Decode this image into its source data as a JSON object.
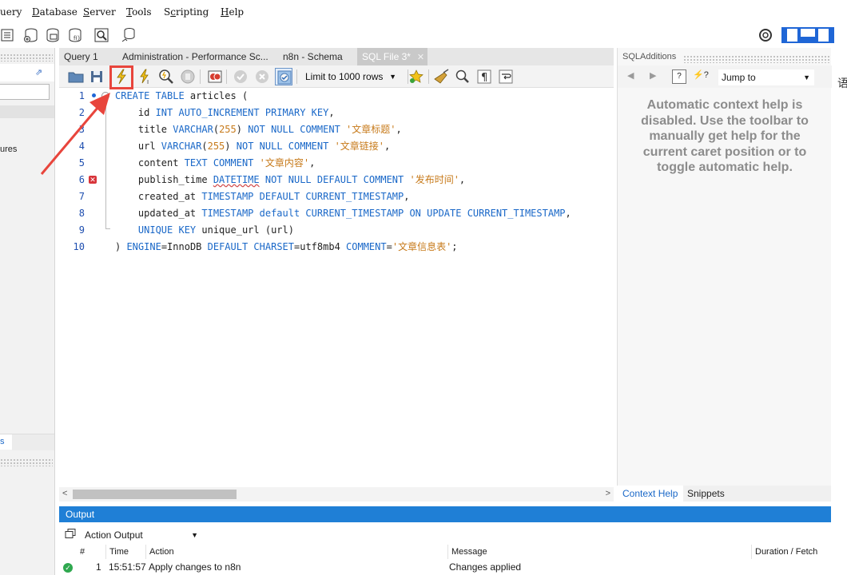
{
  "menu": [
    "uery",
    "Database",
    "Server",
    "Tools",
    "Scripting",
    "Help"
  ],
  "menu_mnemonics": {
    "Database": "D",
    "Server": "S",
    "Tools": "T",
    "Scripting": "c",
    "Help": "H"
  },
  "sidebar": {
    "partial_item": "ures",
    "partial_tab": "s"
  },
  "tabs": [
    {
      "label": "Query 1",
      "active": false
    },
    {
      "label": "Administration - Performance Sc...",
      "active": false
    },
    {
      "label": "n8n - Schema",
      "active": false
    },
    {
      "label": "SQL File 3*",
      "active": true
    }
  ],
  "editor_toolbar": {
    "limit_select": "Limit to 1000 rows"
  },
  "code_lines": [
    {
      "n": "1",
      "tokens": [
        [
          "kw",
          "CREATE TABLE "
        ],
        [
          "id",
          "articles ("
        ]
      ]
    },
    {
      "n": "2",
      "tokens": [
        [
          "id",
          "    id "
        ],
        [
          "kw",
          "INT AUTO_INCREMENT PRIMARY KEY"
        ],
        [
          "pn",
          ","
        ]
      ]
    },
    {
      "n": "3",
      "tokens": [
        [
          "id",
          "    title "
        ],
        [
          "kw",
          "VARCHAR"
        ],
        [
          "pn",
          "("
        ],
        [
          "str",
          "255"
        ],
        [
          "pn",
          ") "
        ],
        [
          "kw",
          "NOT NULL COMMENT "
        ],
        [
          "str",
          "'文章标题'"
        ],
        [
          "pn",
          ","
        ]
      ]
    },
    {
      "n": "4",
      "tokens": [
        [
          "id",
          "    url "
        ],
        [
          "kw",
          "VARCHAR"
        ],
        [
          "pn",
          "("
        ],
        [
          "str",
          "255"
        ],
        [
          "pn",
          ") "
        ],
        [
          "kw",
          "NOT NULL COMMENT "
        ],
        [
          "str",
          "'文章链接'"
        ],
        [
          "pn",
          ","
        ]
      ]
    },
    {
      "n": "5",
      "tokens": [
        [
          "id",
          "    content "
        ],
        [
          "kw",
          "TEXT COMMENT "
        ],
        [
          "str",
          "'文章内容'"
        ],
        [
          "pn",
          ","
        ]
      ]
    },
    {
      "n": "6",
      "tokens": [
        [
          "id",
          "    publish_time "
        ],
        [
          "err",
          "DATETIME"
        ],
        [
          "kw",
          " NOT NULL DEFAULT COMMENT "
        ],
        [
          "str",
          "'发布时间'"
        ],
        [
          "pn",
          ","
        ]
      ]
    },
    {
      "n": "7",
      "tokens": [
        [
          "id",
          "    created_at "
        ],
        [
          "kw",
          "TIMESTAMP DEFAULT CURRENT_TIMESTAMP"
        ],
        [
          "pn",
          ","
        ]
      ]
    },
    {
      "n": "8",
      "tokens": [
        [
          "id",
          "    updated_at "
        ],
        [
          "kw",
          "TIMESTAMP default CURRENT_TIMESTAMP ON UPDATE CURRENT_TIMESTAMP"
        ],
        [
          "pn",
          ","
        ]
      ]
    },
    {
      "n": "9",
      "tokens": [
        [
          "kw",
          "    UNIQUE KEY "
        ],
        [
          "id",
          "unique_url (url)"
        ]
      ]
    },
    {
      "n": "10",
      "tokens": [
        [
          "id",
          ") "
        ],
        [
          "kw",
          "ENGINE"
        ],
        [
          "pn",
          "="
        ],
        [
          "id",
          "InnoDB "
        ],
        [
          "kw",
          "DEFAULT CHARSET"
        ],
        [
          "pn",
          "="
        ],
        [
          "id",
          "utf8mb4 "
        ],
        [
          "kw",
          "COMMENT"
        ],
        [
          "pn",
          "="
        ],
        [
          "str",
          "'文章信息表'"
        ],
        [
          "pn",
          ";"
        ]
      ]
    }
  ],
  "right_panel": {
    "title": "SQLAdditions",
    "jump_to": "Jump to",
    "help_text": "Automatic context help is disabled. Use the toolbar to manually get help for the current caret position or to toggle automatic help.",
    "tabs": [
      "Context Help",
      "Snippets"
    ]
  },
  "output": {
    "header": "Output",
    "select": "Action Output",
    "columns": [
      "#",
      "Time",
      "Action",
      "Message",
      "Duration / Fetch"
    ],
    "rows": [
      {
        "num": "1",
        "time": "15:51:57",
        "action": "Apply changes to n8n",
        "message": "Changes applied",
        "duration": ""
      }
    ]
  },
  "colors": {
    "accent": "#1f7fd6",
    "annotation": "#e8453c",
    "keyword": "#1a68c8",
    "string": "#c77a1a"
  }
}
